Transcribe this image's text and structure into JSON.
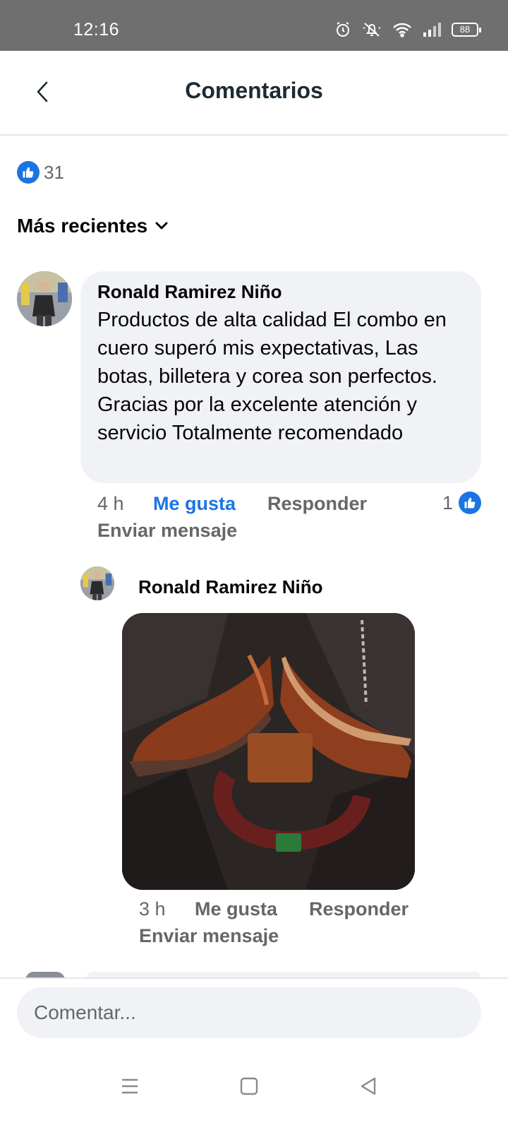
{
  "status_bar": {
    "time": "12:16",
    "battery": "88"
  },
  "header": {
    "title": "Comentarios",
    "back_icon": "chevron-left-icon"
  },
  "reactions": {
    "icon": "like-icon",
    "count": "31"
  },
  "sort": {
    "label": "Más recientes",
    "icon": "chevron-down-icon"
  },
  "comments": [
    {
      "author": "Ronald Ramirez Niño",
      "text": "Productos de alta calidad El combo en cuero superó mis expectativas, Las botas, billetera y corea son perfectos. Gracias por la excelente atención y servicio Totalmente recomendado",
      "time": "4 h",
      "like_label": "Me gusta",
      "reply_label": "Responder",
      "message_label": "Enviar mensaje",
      "like_count": "1"
    }
  ],
  "reply": {
    "author": "Ronald Ramirez Niño",
    "time": "3 h",
    "like_label": "Me gusta",
    "reply_label": "Responder",
    "message_label": "Enviar mensaje"
  },
  "composer": {
    "placeholder": "Comentar..."
  },
  "colors": {
    "accent": "#1b74e4",
    "bubble": "#f0f2f5",
    "muted_text": "#65676b",
    "status_bar": "#6f6f6f"
  }
}
